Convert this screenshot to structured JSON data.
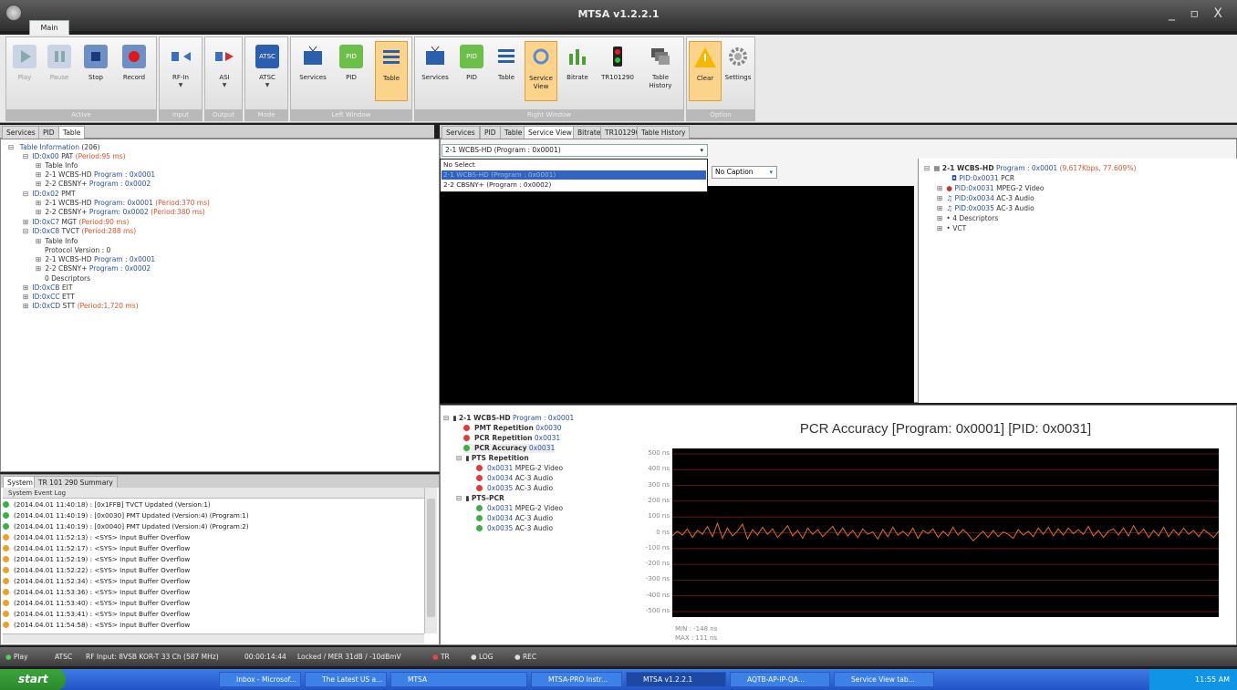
{
  "window": {
    "title": "MTSA v1.2.2.1",
    "controls": "_ ▫ X",
    "ribbon_tab": "Main"
  },
  "ribbon": {
    "groups": [
      {
        "label": "Active"
      },
      {
        "label": "Input"
      },
      {
        "label": "Output"
      },
      {
        "label": "Mode"
      },
      {
        "label": "Left Window"
      },
      {
        "label": "Right Window"
      },
      {
        "label": "Option"
      }
    ],
    "buttons": {
      "play": "Play",
      "pause": "Pause",
      "stop": "Stop",
      "record": "Record",
      "rfin": "RF-In",
      "asi": "ASI",
      "atsc": "ATSC",
      "lw_services": "Services",
      "lw_pid": "PID",
      "lw_table": "Table",
      "rw_services": "Services",
      "rw_pid": "PID",
      "rw_table": "Table",
      "rw_service": "Service",
      "rw_view": "View",
      "rw_bitrate": "Bitrate",
      "rw_tr": "TR101290",
      "rw_table2": "Table",
      "rw_history": "History",
      "clear": "Clear",
      "settings": "Settings"
    },
    "icon_text": {
      "atsc": "ATSC",
      "pid": "PID"
    }
  },
  "left_tabs": [
    "Services",
    "PID",
    "Table"
  ],
  "table_tree": {
    "root": "Table Information",
    "root_count": "(206)",
    "pat": "ID:0x00",
    "pat_name": "PAT",
    "pat_period": "(Period:95 ms)",
    "table_info": "Table Info",
    "p1": "2-1 WCBS-HD",
    "p1_prog": "Program : 0x0001",
    "p2": "2-2 CBSNY+",
    "p2_prog": "Program : 0x0002",
    "pmt": "ID:0x02",
    "pmt_name": "PMT",
    "pmt1_prog": "Program: 0x0001",
    "pmt1_period": "(Period:370 ms)",
    "pmt2_prog": "Program: 0x0002",
    "pmt2_period": "(Period:380 ms)",
    "mgt": "ID:0xC7",
    "mgt_name": "MGT",
    "mgt_period": "(Period:90 ms)",
    "tvct": "ID:0xC8",
    "tvct_name": "TVCT",
    "tvct_period": "(Period:288 ms)",
    "protocol": "Protocol Version : 0",
    "desc": "0 Descriptors",
    "eit": "ID:0xCB",
    "eit_name": "EIT",
    "ett": "ID:0xCC",
    "ett_name": "ETT",
    "stt": "ID:0xCD",
    "stt_name": "STT",
    "stt_period": "(Period:1,720 ms)"
  },
  "log": {
    "tabs": [
      "System",
      "TR 101 290 Summary"
    ],
    "header": "System Event Log",
    "entries": [
      {
        "color": "#3cb043",
        "text": "(2014.04.01 11:40:18) : [0x1FFB] TVCT Updated (Version:1)"
      },
      {
        "color": "#3cb043",
        "text": "(2014.04.01 11:40:19) : [0x0030] PMT Updated (Version:4) (Program:1)"
      },
      {
        "color": "#3cb043",
        "text": "(2014.04.01 11:40:19) : [0x0040] PMT Updated (Version:4) (Program:2)"
      },
      {
        "color": "#f0a020",
        "text": "(2014.04.01 11:52:13) : <SYS> Input Buffer Overflow"
      },
      {
        "color": "#f0a020",
        "text": "(2014.04.01 11:52:17) : <SYS> Input Buffer Overflow"
      },
      {
        "color": "#f0a020",
        "text": "(2014.04.01 11:52:19) : <SYS> Input Buffer Overflow"
      },
      {
        "color": "#f0a020",
        "text": "(2014.04.01 11:52:22) : <SYS> Input Buffer Overflow"
      },
      {
        "color": "#f0a020",
        "text": "(2014.04.01 11:52:34) : <SYS> Input Buffer Overflow"
      },
      {
        "color": "#f0a020",
        "text": "(2014.04.01 11:53:36) : <SYS> Input Buffer Overflow"
      },
      {
        "color": "#f0a020",
        "text": "(2014.04.01 11:53:40) : <SYS> Input Buffer Overflow"
      },
      {
        "color": "#f0a020",
        "text": "(2014.04.01 11:53:41) : <SYS> Input Buffer Overflow"
      },
      {
        "color": "#f0a020",
        "text": "(2014.04.01 11:54:58) : <SYS> Input Buffer Overflow"
      }
    ]
  },
  "right_tabs": [
    "Services",
    "PID",
    "Table",
    "Service View",
    "Bitrate",
    "TR101290",
    "Table History"
  ],
  "service_view": {
    "program_select": "2-1 WCBS-HD (Program : 0x0001)",
    "dropdown": [
      "No Select",
      "2-1 WCBS-HD (Program : 0x0001)",
      "2-2 CBSNY+ (Program : 0x0002)"
    ],
    "caption_select": "No Caption",
    "tree": {
      "prog": "2-1 WCBS-HD",
      "prog_id": "Program : 0x0001",
      "prog_rate": "(9,617Kbps, 77.609%)",
      "pcr_pid": "PID:0x0031",
      "pcr": "PCR",
      "video_pid": "PID:0x0031",
      "video": "MPEG-2 Video",
      "a1_pid": "PID:0x0034",
      "a1": "AC-3 Audio",
      "a2_pid": "PID:0x0035",
      "a2": "AC-3 Audio",
      "desc": "4 Descriptors",
      "vct": "VCT"
    }
  },
  "measure_tree": {
    "prog": "2-1 WCBS-HD",
    "prog_id": "Program : 0x0001",
    "pmt_rep": "PMT Repetition",
    "pmt_rep_pid": "0x0030",
    "pcr_rep": "PCR Repetition",
    "pcr_rep_pid": "0x0031",
    "pcr_acc": "PCR Accuracy",
    "pcr_acc_pid": "0x0031",
    "pts_rep": "PTS Repetition",
    "pts1_pid": "0x0031",
    "pts1": "MPEG-2 Video",
    "pts2_pid": "0x0034",
    "pts2": "AC-3 Audio",
    "pts3_pid": "0x0035",
    "pts3": "AC-3 Audio",
    "ptspcr": "PTS-PCR",
    "pp1_pid": "0x0031",
    "pp1": "MPEG-2 Video",
    "pp2_pid": "0x0034",
    "pp2": "AC-3 Audio",
    "pp3_pid": "0x0035",
    "pp3": "AC-3 Audio"
  },
  "chart_data": {
    "type": "line",
    "title": "PCR Accuracy [Program: 0x0001] [PID: 0x0031]",
    "xlabel": "",
    "ylabel": "",
    "ylim": [
      -500,
      500
    ],
    "yticks": [
      "500 ns",
      "400 ns",
      "300 ns",
      "200 ns",
      "100 ns",
      "0 ns",
      "-100 ns",
      "-200 ns",
      "-300 ns",
      "-400 ns",
      "-500 ns"
    ],
    "ytick_values": [
      500,
      400,
      300,
      200,
      100,
      0,
      -100,
      -200,
      -300,
      -400,
      -500
    ],
    "series": [
      {
        "values": [
          -20,
          10,
          -15,
          25,
          -30,
          15,
          -10,
          40,
          -25,
          60,
          -35,
          30,
          -20,
          10,
          55,
          -40,
          20,
          -15,
          35,
          -10,
          25,
          -30,
          5,
          45,
          -20,
          15,
          -35,
          30,
          -10,
          20,
          -25,
          10,
          40,
          -15,
          30,
          -20,
          15,
          -30,
          25,
          -10,
          5,
          -40,
          20,
          -25,
          35,
          -15,
          10,
          -20,
          30,
          -35,
          15,
          -5,
          25,
          -30,
          10,
          -20,
          35,
          -15,
          20,
          -10,
          -50,
          -20,
          10,
          -30,
          15,
          -25,
          5,
          -10,
          -35,
          20,
          -15,
          10,
          -25,
          30,
          -10,
          35,
          -20,
          25,
          -15,
          30,
          -5,
          20,
          -10,
          40,
          -20,
          15,
          -30,
          10,
          25,
          -15,
          30,
          -20,
          45,
          -10,
          25,
          -30,
          15,
          -20,
          35,
          -25,
          20,
          -15,
          30,
          -10,
          15,
          -25,
          20,
          -5,
          -30,
          10
        ]
      }
    ],
    "min_label": "MIN : -148 ns",
    "max_label": "MAX : 111 ns",
    "line_color": "#e07020"
  },
  "statusbar": {
    "play": "Play",
    "atsc": "ATSC",
    "rf": "RF Input: 8VSB KOR-T 33 Ch (587 MHz)",
    "time": "00:00:14:44",
    "lock": "Locked / MER 31dB / -10dBmV",
    "tr": "TR",
    "log": "LOG",
    "rec": "REC"
  },
  "taskbar": {
    "start": "start",
    "tasks": [
      "Inbox - Microsof...",
      "The Latest US a...",
      "MTSA",
      "MTSA-PRO Instr...",
      "MTSA v1.2.2.1",
      "AQTB-AP-IP-QA...",
      "Service View tab..."
    ],
    "clock": "11:55 AM"
  }
}
